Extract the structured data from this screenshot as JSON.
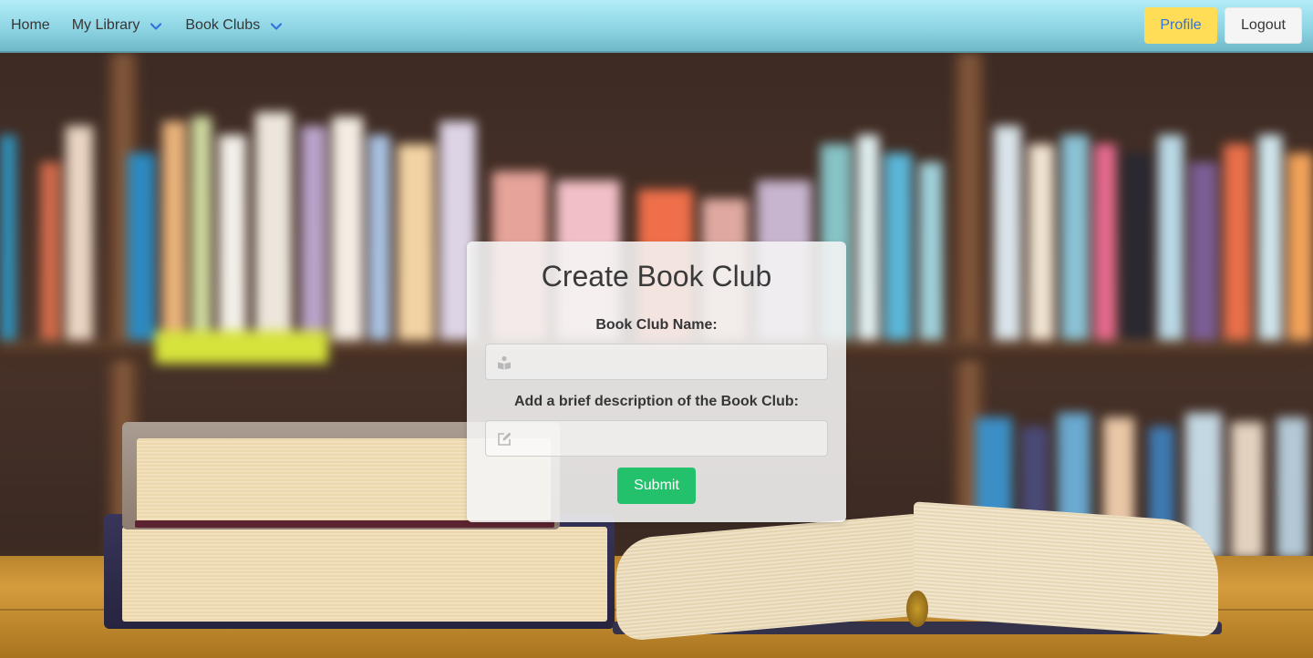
{
  "navbar": {
    "home_label": "Home",
    "my_library_label": "My Library",
    "book_clubs_label": "Book Clubs",
    "profile_label": "Profile",
    "logout_label": "Logout"
  },
  "form": {
    "title": "Create Book Club",
    "name_label": "Book Club Name:",
    "name_value": "",
    "name_placeholder": "",
    "description_label": "Add a brief description of the Book Club:",
    "description_value": "",
    "description_placeholder": "",
    "submit_label": "Submit"
  },
  "icons": {
    "chevron": "chevron-down-icon",
    "name_field": "book-reader-icon",
    "description_field": "edit-icon"
  },
  "colors": {
    "navbar_top": "#b2ecf8",
    "navbar_bottom": "#6fb9c9",
    "profile_bg": "#ffdd57",
    "profile_text": "#3273dc",
    "logout_bg": "#f5f5f5",
    "submit_bg": "#23c16b",
    "chevron": "#3273dc"
  }
}
